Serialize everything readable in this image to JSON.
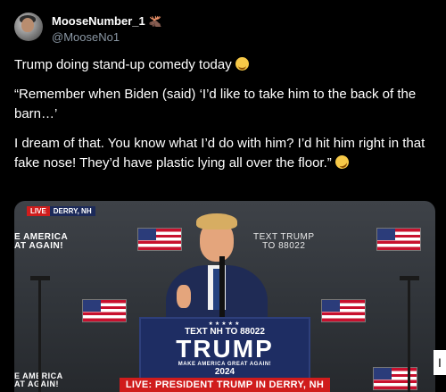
{
  "author": {
    "display_name": "MooseNumber_1",
    "badge_icon": "moose-icon",
    "handle": "@MooseNo1"
  },
  "tweet": {
    "line1": "Trump doing stand-up comedy today",
    "line2": "“Remember when Biden (said) ‘I’d like to take him to the back of the barn…’",
    "line3": "I dream of that. You know what I’d do with him? I’d hit him right in that fake nose! They’d have plastic lying all over the floor.”"
  },
  "media": {
    "live_label": "LIVE",
    "location_label": "DERRY, NH",
    "wall_left_top": "E AMERICA\nAT AGAIN!",
    "wall_left_bottom": "E AMERICA\nAT AGAIN!",
    "wall_right": "TEXT TRUMP\nTO 88022",
    "podium_text_nh": "TEXT NH TO 88022",
    "podium_name": "TRUMP",
    "podium_slogan": "MAKE AMERICA GREAT AGAIN!",
    "podium_year": "2024",
    "lower_third": "LIVE: PRESIDENT TRUMP IN DERRY, NH"
  },
  "side_button_label": "I",
  "colors": {
    "background": "#000000",
    "text": "#ffffff",
    "muted": "#8b98a5",
    "live_red": "#d01c1c",
    "navy": "#1e2d63"
  }
}
